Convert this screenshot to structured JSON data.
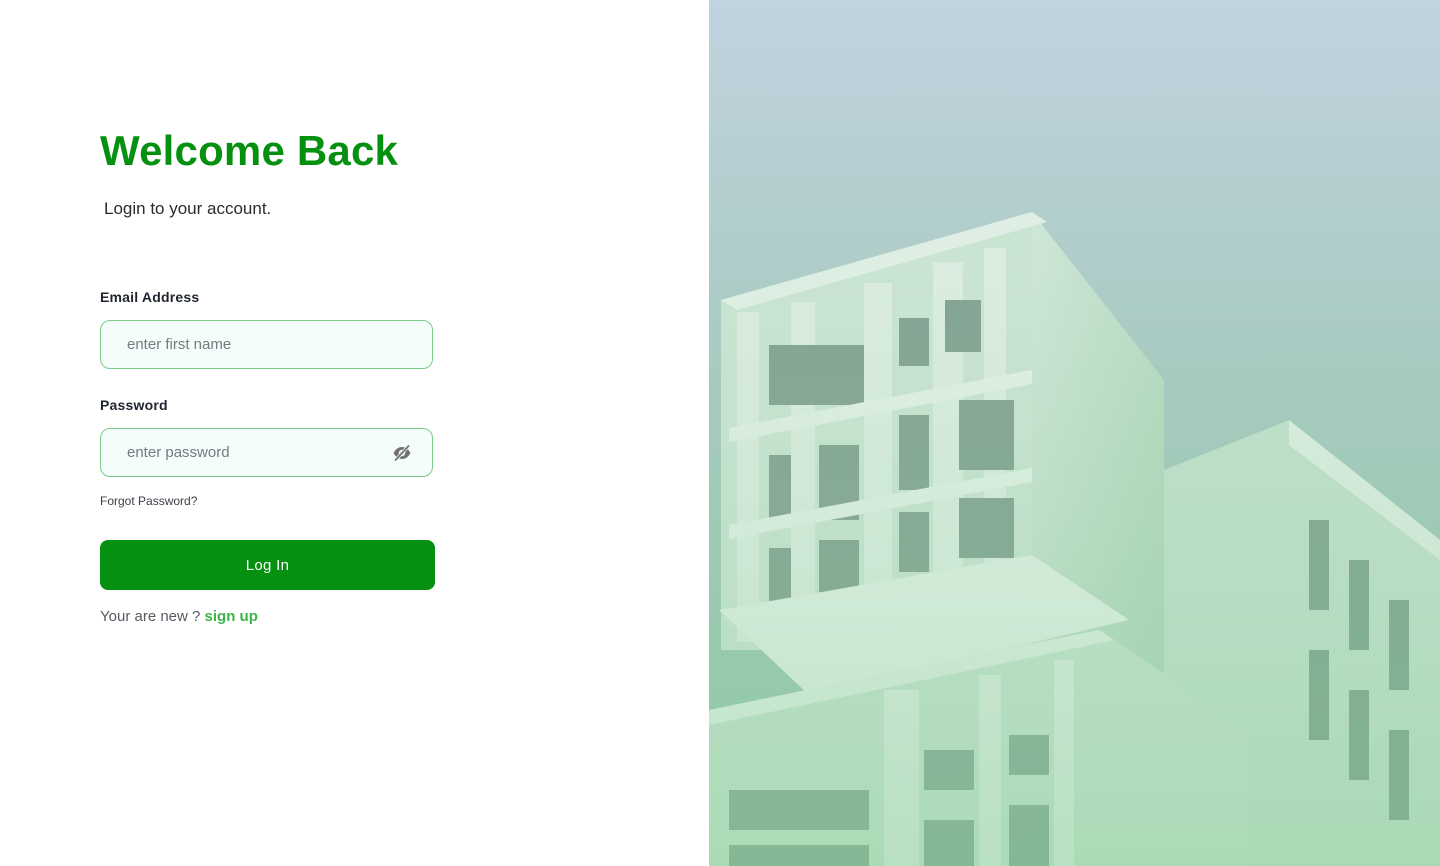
{
  "login": {
    "title": "Welcome Back",
    "subtitle": "Login to your account.",
    "email": {
      "label": "Email Address",
      "placeholder": "enter first name",
      "value": ""
    },
    "password": {
      "label": "Password",
      "placeholder": "enter password",
      "value": "",
      "toggle_icon": "eye-off-icon"
    },
    "forgot_label": "Forgot Password?",
    "login_button_label": "Log In",
    "signup_prompt": "Your are new ?",
    "signup_link_label": "sign up"
  },
  "theme": {
    "accent": "#05900f",
    "link_accent": "#3bb54a",
    "input_border": "#7ecc8a",
    "input_background": "#f5fdfb"
  },
  "hero": {
    "image": "modern-building-photo"
  }
}
